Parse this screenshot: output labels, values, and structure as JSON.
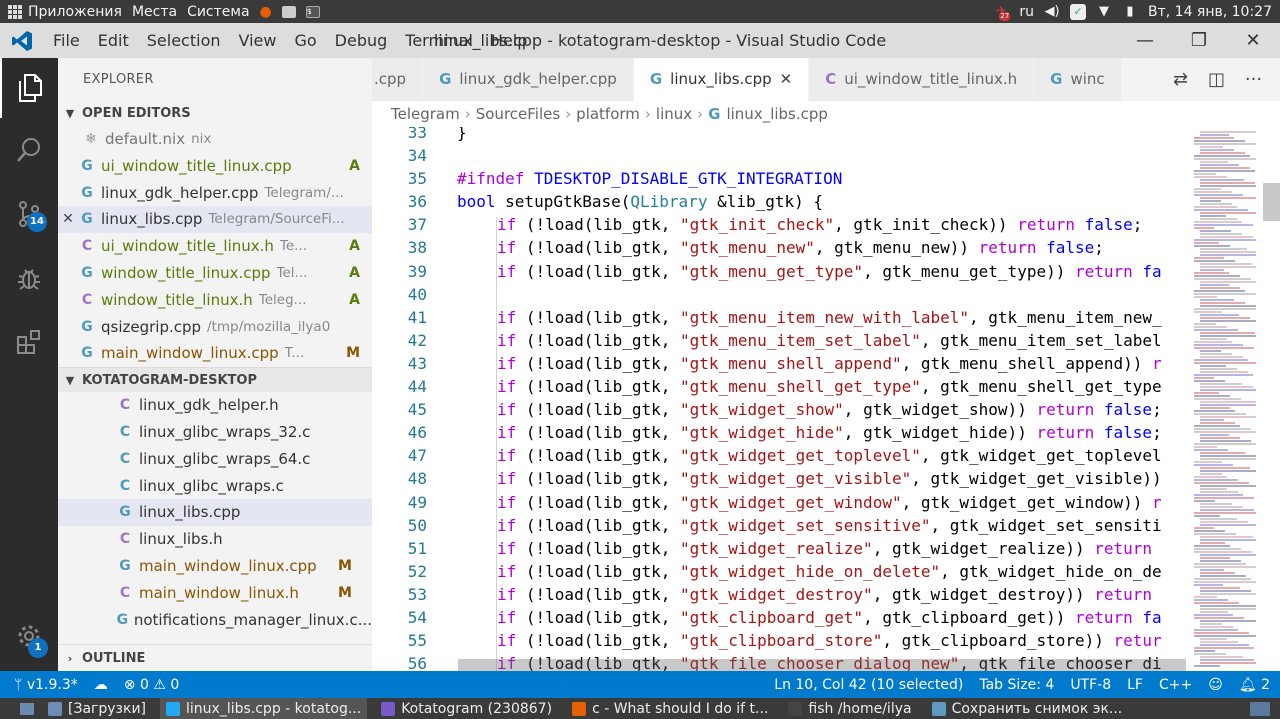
{
  "system_top": {
    "apps": "Приложения",
    "places": "Места",
    "system": "Система",
    "badge_count": "27",
    "lang": "ru",
    "datetime": "Вт, 14 янв, 10:27"
  },
  "titlebar": {
    "menu": [
      "File",
      "Edit",
      "Selection",
      "View",
      "Go",
      "Debug",
      "Terminal",
      "Help"
    ],
    "title": "linux_libs.cpp - kotatogram-desktop - Visual Studio Code"
  },
  "activity": {
    "scm_badge": "14",
    "settings_badge": "1"
  },
  "sidebar": {
    "title": "EXPLORER",
    "open_editors_title": "OPEN EDITORS",
    "open_editors": [
      {
        "icon": "nix-file-icon",
        "glyph": "❄",
        "name": "default.nix",
        "desc": "nix",
        "status": "",
        "kind": "nix",
        "color": "dim"
      },
      {
        "icon": "cpp-file-icon",
        "glyph": "G",
        "name": "ui_window_title_linux.cpp",
        "desc": "",
        "status": "A",
        "kind": "cpp",
        "color": "green"
      },
      {
        "icon": "cpp-file-icon",
        "glyph": "G",
        "name": "linux_gdk_helper.cpp",
        "desc": "Telegram/...",
        "status": "",
        "kind": "cpp",
        "color": ""
      },
      {
        "icon": "cpp-file-icon",
        "glyph": "G",
        "name": "linux_libs.cpp",
        "desc": "Telegram/SourceFi...",
        "status": "",
        "kind": "cpp",
        "color": "",
        "selected": true
      },
      {
        "icon": "h-file-icon",
        "glyph": "C",
        "name": "ui_window_title_linux.h",
        "desc": "Te...",
        "status": "A",
        "kind": "h",
        "color": "green"
      },
      {
        "icon": "cpp-file-icon",
        "glyph": "G",
        "name": "window_title_linux.cpp",
        "desc": "Tel...",
        "status": "A",
        "kind": "cpp",
        "color": "green"
      },
      {
        "icon": "h-file-icon",
        "glyph": "C",
        "name": "window_title_linux.h",
        "desc": "Teleg...",
        "status": "A",
        "kind": "h",
        "color": "green"
      },
      {
        "icon": "cpp-file-icon",
        "glyph": "G",
        "name": "qsizegrip.cpp",
        "desc": "/tmp/mozilla_ilya0",
        "status": "",
        "kind": "cpp",
        "color": ""
      },
      {
        "icon": "cpp-file-icon",
        "glyph": "G",
        "name": "main_window_linux.cpp",
        "desc": "T...",
        "status": "M",
        "kind": "cpp",
        "color": "orange"
      }
    ],
    "project_title": "KOTATOGRAM-DESKTOP",
    "project_files": [
      {
        "icon": "h-file-icon",
        "glyph": "C",
        "name": "linux_gdk_helper.h",
        "status": "",
        "kind": "h",
        "color": ""
      },
      {
        "icon": "c-file-icon",
        "glyph": "C",
        "name": "linux_glibc_wraps_32.c",
        "status": "",
        "kind": "cpp",
        "color": ""
      },
      {
        "icon": "c-file-icon",
        "glyph": "C",
        "name": "linux_glibc_wraps_64.c",
        "status": "",
        "kind": "cpp",
        "color": ""
      },
      {
        "icon": "c-file-icon",
        "glyph": "C",
        "name": "linux_glibc_wraps.c",
        "status": "",
        "kind": "cpp",
        "color": ""
      },
      {
        "icon": "cpp-file-icon",
        "glyph": "G",
        "name": "linux_libs.cpp",
        "status": "",
        "kind": "cpp",
        "color": "",
        "selected": true
      },
      {
        "icon": "h-file-icon",
        "glyph": "C",
        "name": "linux_libs.h",
        "status": "",
        "kind": "h",
        "color": ""
      },
      {
        "icon": "cpp-file-icon",
        "glyph": "G",
        "name": "main_window_linux.cpp",
        "status": "M",
        "kind": "cpp",
        "color": "orange"
      },
      {
        "icon": "h-file-icon",
        "glyph": "C",
        "name": "main_window_linux.h",
        "status": "M",
        "kind": "h",
        "color": "orange"
      },
      {
        "icon": "cpp-file-icon",
        "glyph": "G",
        "name": "notifications_manager_linux.c...",
        "status": "",
        "kind": "cpp",
        "color": ""
      }
    ],
    "outline_title": "OUTLINE"
  },
  "tabs": [
    {
      "name": ".cpp",
      "glyph": "",
      "kind": "cpp",
      "active": false
    },
    {
      "name": "linux_gdk_helper.cpp",
      "glyph": "G",
      "kind": "cpp",
      "active": false
    },
    {
      "name": "linux_libs.cpp",
      "glyph": "G",
      "kind": "cpp",
      "active": true
    },
    {
      "name": "ui_window_title_linux.h",
      "glyph": "C",
      "kind": "h",
      "active": false
    },
    {
      "name": "winc",
      "glyph": "G",
      "kind": "cpp",
      "active": false
    }
  ],
  "breadcrumb": [
    "Telegram",
    "SourceFiles",
    "platform",
    "linux",
    "linux_libs.cpp"
  ],
  "code": {
    "lines": [
      {
        "n": "33",
        "html": "}",
        "indent": false
      },
      {
        "n": "34",
        "html": "",
        "indent": false
      },
      {
        "n": "35",
        "html": "<span class='pp'>#ifndef</span> <span class='mc'>TDESKTOP_DISABLE_GTK_INTEGRATION</span>",
        "indent": false
      },
      {
        "n": "36",
        "html": "<span class='kw'>bool</span> setupGtkBase(<span class='ty'>QLibrary</span> &amp;lib_gtk) {",
        "indent": false
      },
      {
        "n": "37",
        "html": "<span class='pp'>if</span> (!load(lib_gtk, <span class='str'>\"gtk_init_check\"</span>, gtk_init_check)) <span class='pp'>return</span> <span class='kw'>false</span>;",
        "indent": true
      },
      {
        "n": "38",
        "html": "<span class='pp'>if</span> (!load(lib_gtk, <span class='str'>\"gtk_menu_new\"</span>, gtk_menu_new)) <span class='pp'>return</span> <span class='kw'>false</span>;",
        "indent": true
      },
      {
        "n": "39",
        "html": "<span class='pp'>if</span> (!load(lib_gtk, <span class='str'>\"gtk_menu_get_type\"</span>, gtk_menu_get_type)) <span class='pp'>return</span> <span class='kw'>fa</span>",
        "indent": true
      },
      {
        "n": "40",
        "html": "",
        "indent": false
      },
      {
        "n": "41",
        "html": "<span class='pp'>if</span> (!load(lib_gtk, <span class='str'>\"gtk_menu_item_new_with_label\"</span>, gtk_menu_item_new_",
        "indent": true
      },
      {
        "n": "42",
        "html": "<span class='pp'>if</span> (!load(lib_gtk, <span class='str'>\"gtk_menu_item_set_label\"</span>, gtk_menu_item_set_label",
        "indent": true
      },
      {
        "n": "43",
        "html": "<span class='pp'>if</span> (!load(lib_gtk, <span class='str'>\"gtk_menu_shell_append\"</span>, gtk_menu_shell_append)) <span class='pp'>r</span>",
        "indent": true
      },
      {
        "n": "44",
        "html": "<span class='pp'>if</span> (!load(lib_gtk, <span class='str'>\"gtk_menu_shell_get_type\"</span>, gtk_menu_shell_get_type",
        "indent": true
      },
      {
        "n": "45",
        "html": "<span class='pp'>if</span> (!load(lib_gtk, <span class='str'>\"gtk_widget_show\"</span>, gtk_widget_show)) <span class='pp'>return</span> <span class='kw'>false</span>;",
        "indent": true
      },
      {
        "n": "46",
        "html": "<span class='pp'>if</span> (!load(lib_gtk, <span class='str'>\"gtk_widget_hide\"</span>, gtk_widget_hide)) <span class='pp'>return</span> <span class='kw'>false</span>;",
        "indent": true
      },
      {
        "n": "47",
        "html": "<span class='pp'>if</span> (!load(lib_gtk, <span class='str'>\"gtk_widget_get_toplevel\"</span>, gtk_widget_get_toplevel",
        "indent": true
      },
      {
        "n": "48",
        "html": "<span class='pp'>if</span> (!load(lib_gtk, <span class='str'>\"gtk_widget_get_visible\"</span>, gtk_widget_get_visible))",
        "indent": true
      },
      {
        "n": "49",
        "html": "<span class='pp'>if</span> (!load(lib_gtk, <span class='str'>\"gtk_widget_get_window\"</span>, gtk_widget_get_window)) <span class='pp'>r</span>",
        "indent": true
      },
      {
        "n": "50",
        "html": "<span class='pp'>if</span> (!load(lib_gtk, <span class='str'>\"gtk_widget_set_sensitive\"</span>, gtk_widget_set_sensiti",
        "indent": true
      },
      {
        "n": "51",
        "html": "<span class='pp'>if</span> (!load(lib_gtk, <span class='str'>\"gtk_widget_realize\"</span>, gtk_widget_realize)) <span class='pp'>return</span>",
        "indent": true
      },
      {
        "n": "52",
        "html": "<span class='pp'>if</span> (!load(lib_gtk, <span class='str'>\"gtk_widget_hide_on_delete\"</span>, gtk_widget_hide_on_de",
        "indent": true
      },
      {
        "n": "53",
        "html": "<span class='pp'>if</span> (!load(lib_gtk, <span class='str'>\"gtk_widget_destroy\"</span>, gtk_widget_destroy)) <span class='pp'>return</span>",
        "indent": true
      },
      {
        "n": "54",
        "html": "<span class='pp'>if</span> (!load(lib_gtk, <span class='str'>\"gtk_clipboard_get\"</span>, gtk_clipboard_get)) <span class='pp'>return</span> <span class='kw'>fa</span>",
        "indent": true
      },
      {
        "n": "55",
        "html": "<span class='pp'>if</span> (!load(lib_gtk, <span class='str'>\"gtk_clipboard_store\"</span>, gtk_clipboard_store)) <span class='pp'>retur</span>",
        "indent": true
      },
      {
        "n": "56",
        "html": "<span class='pp'>if</span> (!load(lib_gtk, <span class='str'>\"gtk_file_chooser_dialog_new\"</span>, gtk_file_chooser_di",
        "indent": true
      }
    ]
  },
  "status": {
    "branch": "v1.9.3*",
    "problems": "⊗ 0 ⚠ 0",
    "position": "Ln 10, Col 42 (10 selected)",
    "tab_size": "Tab Size: 4",
    "encoding": "UTF-8",
    "eol": "LF",
    "language": "C++",
    "notifications": "2"
  },
  "taskbar": [
    {
      "label": "[Загрузки]",
      "icon": "folder-icon",
      "color": "#6e8db5",
      "active": false
    },
    {
      "label": "linux_libs.cpp - kotatog...",
      "icon": "vscode-icon",
      "color": "#23a9f2",
      "active": true
    },
    {
      "label": "Kotatogram (230867)",
      "icon": "kotatogram-icon",
      "color": "#7a5ac8",
      "active": false
    },
    {
      "label": "c - What should I do if t...",
      "icon": "firefox-icon",
      "color": "#e66000",
      "active": false
    },
    {
      "label": "fish /home/ilya",
      "icon": "terminal-icon",
      "color": "#444444",
      "active": false
    },
    {
      "label": "Сохранить снимок эк...",
      "icon": "screenshot-icon",
      "color": "#5c9ac0",
      "active": false
    }
  ],
  "colors": {
    "accent": "#007acc",
    "activity_bar": "#2c2c2c",
    "sidebar": "#f3f3f3"
  }
}
